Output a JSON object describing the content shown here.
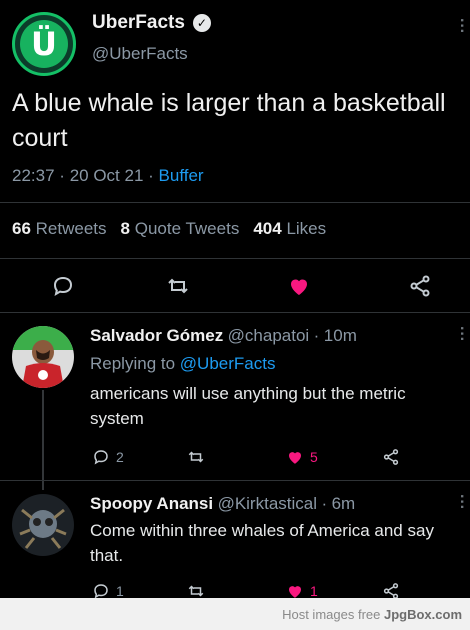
{
  "account": {
    "name": "UberFacts",
    "handle": "@UberFacts",
    "avatar_glyph": "Ü",
    "verified_glyph": "✓"
  },
  "tweet": {
    "text": "A blue whale is larger than a basketball court",
    "time": "22:37",
    "sep1": "·",
    "date": "20 Oct 21",
    "sep2": "·",
    "source": "Buffer"
  },
  "stats": {
    "retweets_count": "66",
    "retweets_label": "Retweets",
    "quotes_count": "8",
    "quotes_label": "Quote Tweets",
    "likes_count": "404",
    "likes_label": "Likes"
  },
  "actions": {
    "reply_icon": "reply-icon",
    "retweet_icon": "retweet-icon",
    "like_icon": "heart-icon",
    "share_icon": "share-icon"
  },
  "replies": [
    {
      "name": "Salvador Gómez",
      "handle": "@chapatoi",
      "sep": "·",
      "time": "10m",
      "replying_prefix": "Replying to",
      "replying_to": "@UberFacts",
      "text": "americans will use anything but the metric system",
      "reply_count": "2",
      "like_count": "5"
    },
    {
      "name": "Spoopy Anansi",
      "handle": "@Kirktastical",
      "sep": "·",
      "time": "6m",
      "text": "Come within three whales of America and say that.",
      "reply_count": "1",
      "like_count": "1"
    }
  ],
  "footer": {
    "prefix": "Host images free",
    "brand": "JpgBox.com"
  },
  "colors": {
    "accent": "#1d9bf0",
    "like": "#f91880",
    "brand_green": "#17b25f"
  }
}
